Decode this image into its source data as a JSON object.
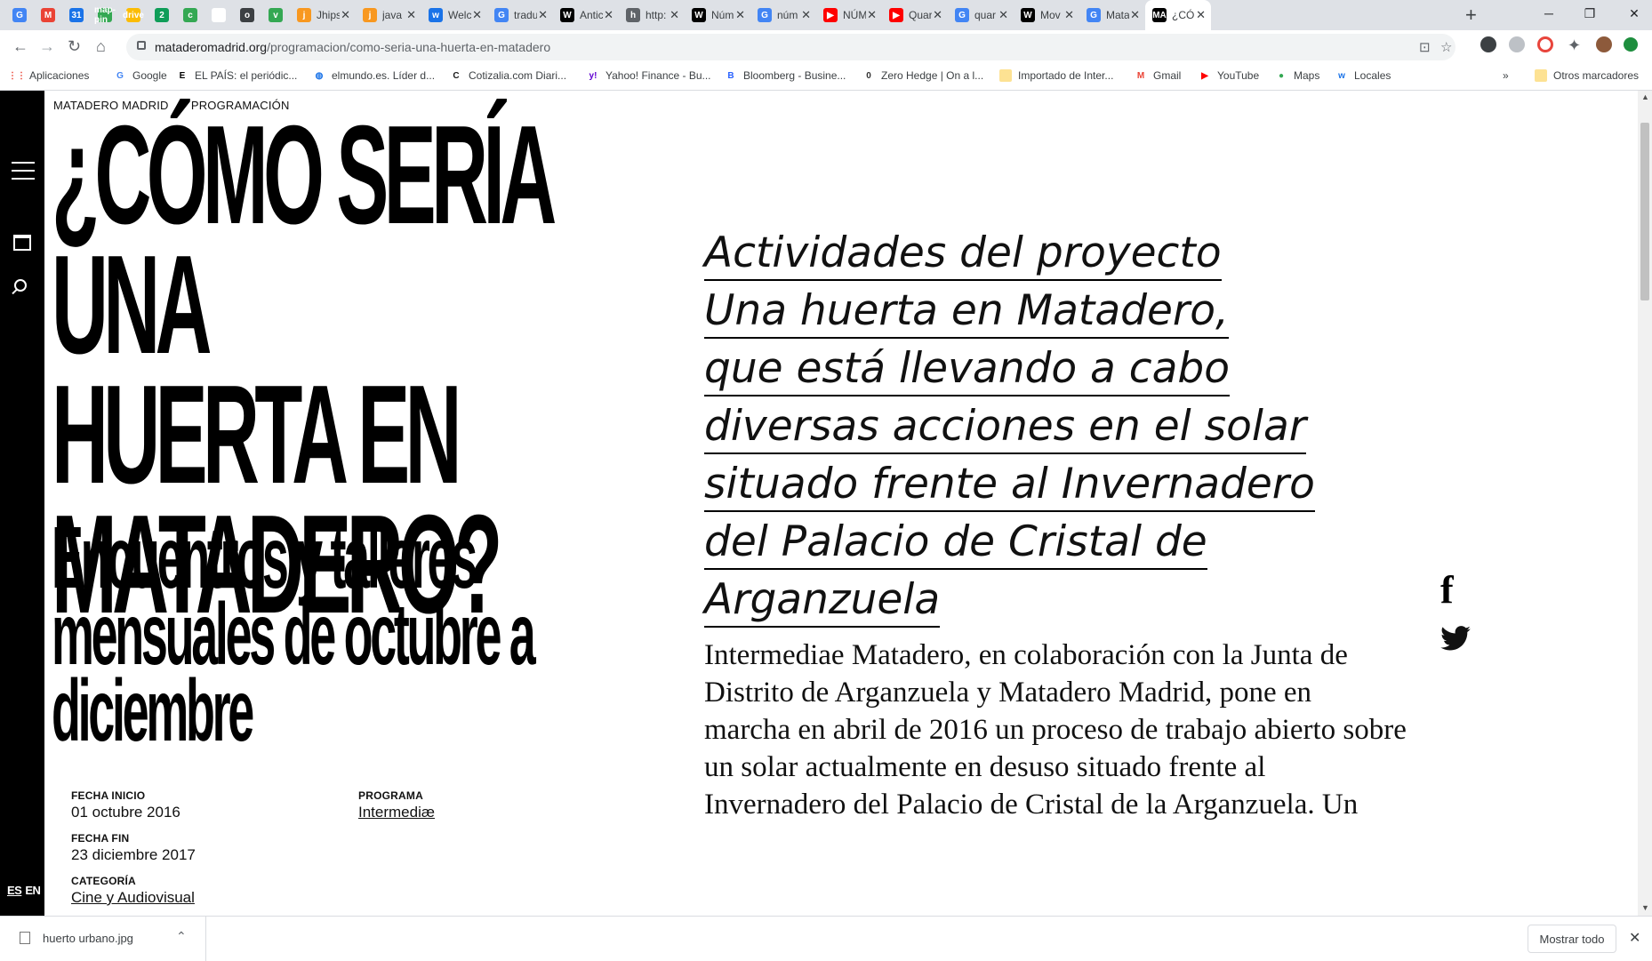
{
  "browser": {
    "tabs": [
      {
        "favicon": "G",
        "title": "",
        "color": "#4285f4"
      },
      {
        "favicon": "M",
        "title": "",
        "color": "#ea4335"
      },
      {
        "favicon": "31",
        "title": "",
        "color": "#1a73e8"
      },
      {
        "favicon": "map-pin",
        "title": "",
        "color": "#34a853"
      },
      {
        "favicon": "drive",
        "title": "",
        "color": "#fbbc04"
      },
      {
        "favicon": "2",
        "title": "",
        "color": "#0f9d58"
      },
      {
        "favicon": "c",
        "title": "",
        "color": "#34a853"
      },
      {
        "favicon": "",
        "title": "",
        "color": "#ffffff"
      },
      {
        "favicon": "o",
        "title": "",
        "color": "#3c4043"
      },
      {
        "favicon": "v",
        "title": "",
        "color": "#34a853"
      },
      {
        "favicon": "j",
        "title": "Jhips",
        "color": "#f89820"
      },
      {
        "favicon": "j",
        "title": "java",
        "color": "#f89820"
      },
      {
        "favicon": "w",
        "title": "Welc",
        "color": "#1a73e8"
      },
      {
        "favicon": "G",
        "title": "tradu",
        "color": "#4285f4"
      },
      {
        "favicon": "W",
        "title": "Antic",
        "color": "#000000"
      },
      {
        "favicon": "h",
        "title": "http:",
        "color": "#5f6368"
      },
      {
        "favicon": "W",
        "title": "Núm",
        "color": "#000000"
      },
      {
        "favicon": "G",
        "title": "núm",
        "color": "#4285f4"
      },
      {
        "favicon": "▶",
        "title": "NÚM",
        "color": "#ff0000"
      },
      {
        "favicon": "▶",
        "title": "Quar",
        "color": "#ff0000"
      },
      {
        "favicon": "G",
        "title": "quar",
        "color": "#4285f4"
      },
      {
        "favicon": "W",
        "title": "Mov",
        "color": "#000000"
      },
      {
        "favicon": "G",
        "title": "Mata",
        "color": "#4285f4"
      },
      {
        "favicon": "MA",
        "title": "¿CÓI",
        "color": "#000000"
      }
    ],
    "url_host": "mataderomadrid.org",
    "url_path": "/programacion/como-seria-una-huerta-en-matadero",
    "bookmarks": [
      {
        "label": "Aplicaciones",
        "icon": "apps-grid"
      },
      {
        "label": "Google",
        "icon": "G"
      },
      {
        "label": "EL PAÍS: el periódic...",
        "icon": "E"
      },
      {
        "label": "elmundo.es. Líder d...",
        "icon": "globe"
      },
      {
        "label": "Cotizalia.com Diari...",
        "icon": "C"
      },
      {
        "label": "Yahoo! Finance - Bu...",
        "icon": "y!"
      },
      {
        "label": "Bloomberg - Busine...",
        "icon": "B"
      },
      {
        "label": "Zero Hedge | On a l...",
        "icon": "0"
      },
      {
        "label": "Importado de Inter...",
        "icon": "folder"
      },
      {
        "label": "Gmail",
        "icon": "M"
      },
      {
        "label": "YouTube",
        "icon": "▶"
      },
      {
        "label": "Maps",
        "icon": "map-pin"
      },
      {
        "label": "Locales",
        "icon": "w"
      }
    ],
    "bookmarks_more": "»",
    "other_bookmarks": "Otros marcadores"
  },
  "page": {
    "breadcrumb": {
      "home": "MATADERO MADRID",
      "section": "PROGRAMACIÓN"
    },
    "title_lines": [
      "¿CÓMO SERÍA UNA",
      "HUERTA EN",
      "MATADERO?"
    ],
    "subtitle_lines": [
      "Encuentros y talleres",
      "mensuales de octubre a",
      "diciembre"
    ],
    "meta": {
      "start_label": "FECHA INICIO",
      "start_value": "01 octubre 2016",
      "end_label": "FECHA FIN",
      "end_value": "23 diciembre 2017",
      "category_label": "CATEGORÍA",
      "category_value": "Cine y Audiovisual",
      "program_label": "PROGRAMA",
      "program_value": "Intermediæ"
    },
    "lead_lines": [
      "Actividades del proyecto",
      "Una huerta en Matadero,",
      "que está llevando a cabo",
      "diversas acciones en el solar",
      "situado frente al Invernadero",
      "del Palacio de Cristal de",
      "Arganzuela"
    ],
    "body_lines": [
      "Intermediae Matadero, en colaboración con la Junta de",
      "Distrito de Arganzuela y Matadero Madrid, pone en",
      "marcha en abril de 2016 un proceso de trabajo abierto sobre",
      "un solar actualmente en desuso situado frente al",
      "Invernadero del Palacio de Cristal de la Arganzuela. Un"
    ],
    "lang": {
      "es": "ES",
      "en": "EN"
    },
    "share": {
      "facebook": "f"
    }
  },
  "downloads": {
    "file": "huerto urbano.jpg",
    "show_all": "Mostrar todo"
  }
}
